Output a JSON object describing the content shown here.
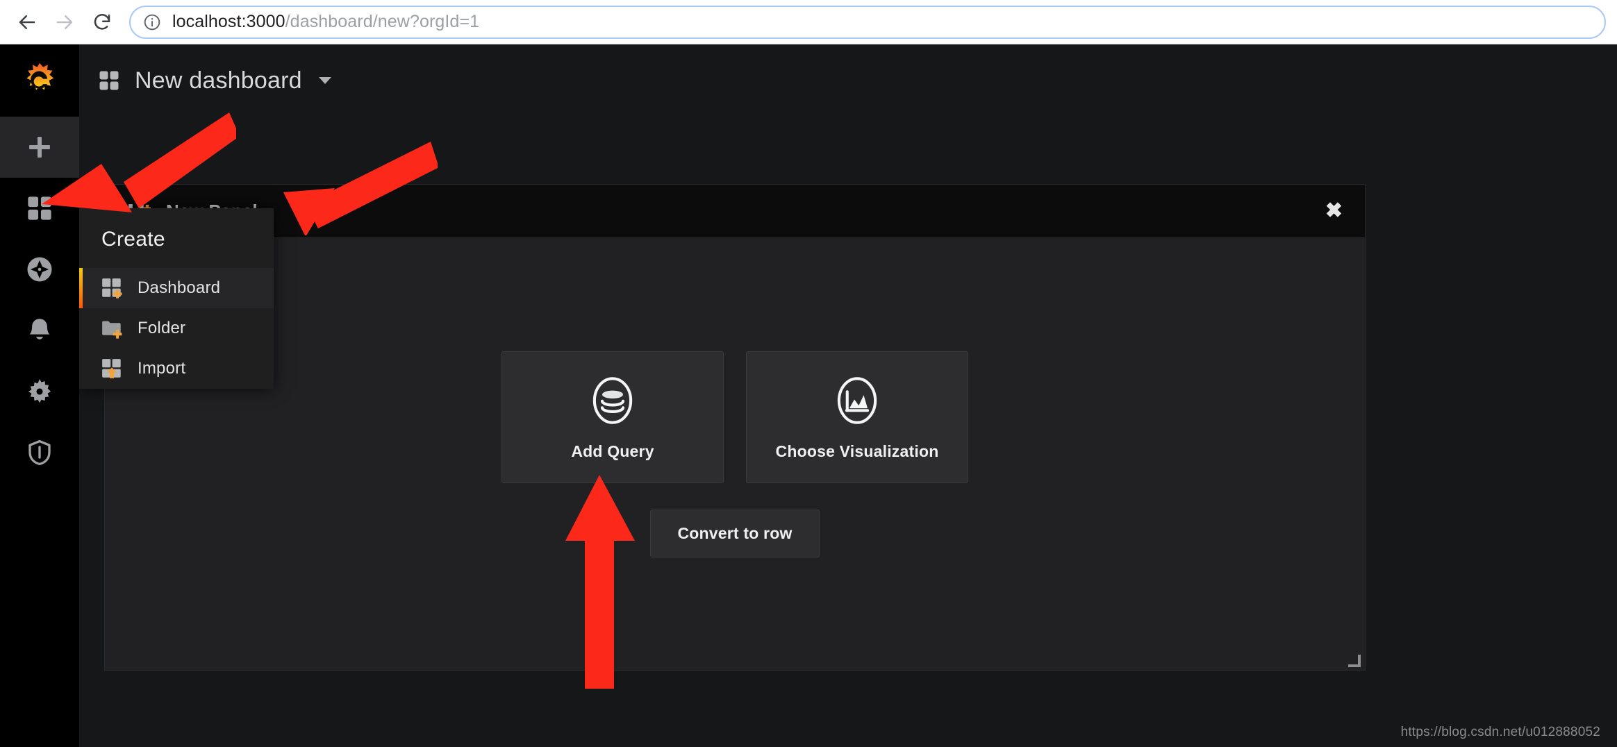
{
  "browser": {
    "back_label": "Back",
    "forward_label": "Forward",
    "reload_label": "Reload",
    "info_icon": "info-circle-icon",
    "url_host": "localhost:3000",
    "url_path": "/dashboard/new?orgId=1",
    "url_full": "localhost:3000/dashboard/new?orgId=1"
  },
  "sidebar": {
    "brand": "grafana-logo",
    "items": [
      {
        "name": "create",
        "icon": "plus-icon",
        "active": true
      },
      {
        "name": "dashboards",
        "icon": "apps-grid-icon",
        "active": false
      },
      {
        "name": "explore",
        "icon": "compass-icon",
        "active": false
      },
      {
        "name": "alerting",
        "icon": "bell-icon",
        "active": false
      },
      {
        "name": "configuration",
        "icon": "gear-icon",
        "active": false
      },
      {
        "name": "server-admin",
        "icon": "shield-icon",
        "active": false
      }
    ]
  },
  "dashboard": {
    "icon": "apps-grid-icon",
    "title": "New dashboard",
    "caret": "chevron-down-icon"
  },
  "panel": {
    "icon": "panel-add-icon",
    "title": "New Panel",
    "close_label": "✖",
    "cta": [
      {
        "label": "Add Query",
        "icon": "database-icon"
      },
      {
        "label": "Choose Visualization",
        "icon": "graph-picture-icon"
      }
    ],
    "convert_label": "Convert to row"
  },
  "create_menu": {
    "heading": "Create",
    "items": [
      {
        "label": "Dashboard",
        "icon": "dashboard-add-icon",
        "active": true
      },
      {
        "label": "Folder",
        "icon": "folder-add-icon",
        "active": false
      },
      {
        "label": "Import",
        "icon": "import-icon",
        "active": false
      }
    ]
  },
  "annotations": {
    "arrow_to_create_label": "arrow pointing to the create (+) sidebar button",
    "arrow_to_dashboard_label": "arrow pointing to the Dashboard menu item",
    "arrow_to_add_query_label": "arrow pointing to the Add Query button"
  },
  "watermark": "https://blog.csdn.net/u012888052",
  "colors": {
    "accent_orange": "#ff5705",
    "accent_yellow": "#f2cc0c",
    "annotation_red": "#fc2819",
    "panel_bg": "#212124",
    "app_bg": "#161719",
    "sidebar_bg": "#000000"
  }
}
